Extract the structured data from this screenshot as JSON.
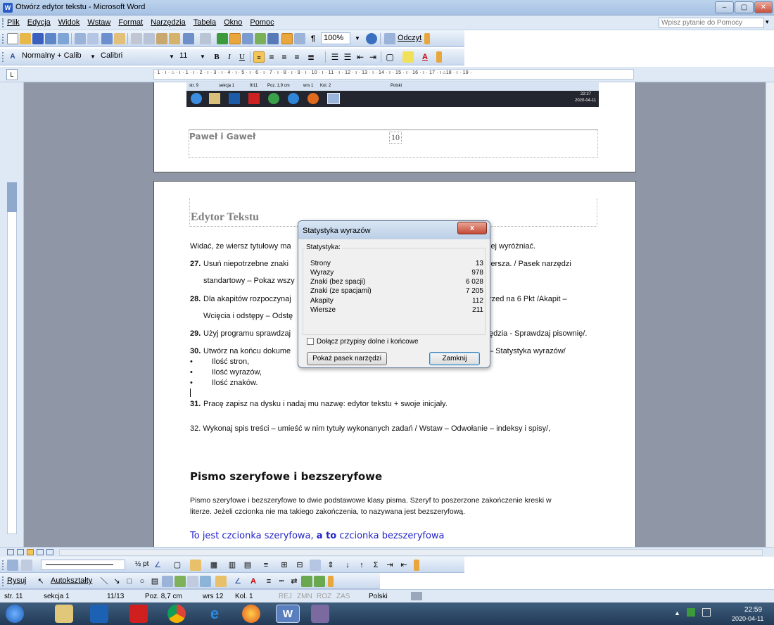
{
  "window": {
    "title": "Otwórz edytor tekstu - Microsoft Word",
    "app_letter": "W"
  },
  "caption_buttons": {
    "minimize": "–",
    "maximize": "▢",
    "close": "✕"
  },
  "menu": [
    "Plik",
    "Edycja",
    "Widok",
    "Wstaw",
    "Format",
    "Narzędzia",
    "Tabela",
    "Okno",
    "Pomoc"
  ],
  "help": {
    "placeholder": "Wpisz pytanie do Pomocy",
    "arrow": "▾"
  },
  "toolbar_standard": {
    "zoom": "100%",
    "read_label": "Odczyt"
  },
  "toolbar_format": {
    "style": "Normalny + Calib",
    "font": "Calibri",
    "size": "11",
    "bold": "B",
    "italic": "I",
    "underline": "U"
  },
  "ruler": {
    "corner": "L",
    "numbers": "· 1 · ı · ⌂ · ı · 1 · ı · 2 · ı · 3 · ı · 4 · ı · 5 · ı · 6 · ı · 7 · ı · 8 · ı · 9 · ı · 10 · ı · 11 · ı · 12 · ı · 13 · ı · 14 · ı · 15 · ı · 16 · ı · 17 · ı ⌂18 · ı · 19 ·"
  },
  "page1": {
    "mini_status": [
      "str. 9",
      "sekcja 1",
      "9/11",
      "Poz. 1,9 cm",
      "wrs 1",
      "Kol. 2",
      "Polski"
    ],
    "mini_time": "22:27",
    "mini_date": "2020-04-11",
    "footer_text": "Paweł i Gaweł",
    "page_number": "10"
  },
  "page2": {
    "heading": "Edytor Tekstu",
    "intro_left": "Widać, że wiersz tytułowy ma",
    "intro_right": "iej wyróżniać.",
    "items": [
      {
        "num": "27.",
        "left": "Usuń niepotrzebne znaki",
        "right": "iersza. / Pasek narzędzi"
      },
      {
        "num": "",
        "left": "standartowy – Pokaz wszy",
        "right": ""
      },
      {
        "num": "28.",
        "left": "Dla akapitów rozpoczynaj",
        "right": "rzed na 6 Pkt /Akapit –"
      },
      {
        "num": "",
        "left": "Wcięcia i odstępy – Odstę",
        "right": ""
      },
      {
        "num": "29.",
        "left": "Użyj programu sprawdzaj",
        "right": "ędzia - Sprawdzaj pisownię/."
      },
      {
        "num": "30.",
        "left": "Utwórz na końcu dokume",
        "right": "– Statystyka wyrazów/"
      }
    ],
    "bullets": [
      "Ilość stron,",
      "Ilość wyrazów,",
      "Ilość znaków."
    ],
    "bullet_char": "•",
    "item31_num": "31.",
    "item31": "Pracę zapisz na dysku i nadaj mu nazwę: edytor tekstu + swoje inicjały.",
    "item32": "32. Wykonaj spis treści – umieść w nim tytuły wykonanych zadań / Wstaw – Odwołanie – indeksy i spisy/,",
    "heading2": "Pismo szeryfowe i bezszeryfowe",
    "para1": "Pismo szeryfowe i bezszeryfowe to dwie podstawowe klasy pisma. Szeryf to poszerzone zakończenie kreski w",
    "para2": "literze. Jeżeli czcionka nie ma takiego zakończenia, to nazywana jest bezszeryfową.",
    "blue_1": "To jest czcionka szeryfowa, ",
    "blue_bold": "a to",
    "blue_2": " czcionka bezszeryfowa"
  },
  "dialog": {
    "title": "Statystyka wyrazów",
    "close": "x",
    "group_label": "Statystyka:",
    "stats": [
      {
        "label": "Strony",
        "value": "13"
      },
      {
        "label": "Wyrazy",
        "value": "978"
      },
      {
        "label": "Znaki (bez spacji)",
        "value": "6 028"
      },
      {
        "label": "Znaki (ze spacjami)",
        "value": "7 205"
      },
      {
        "label": "Akapity",
        "value": "112"
      },
      {
        "label": "Wiersze",
        "value": "211"
      }
    ],
    "checkbox": "Dołącz przypisy dolne i końcowe",
    "show_toolbar": "Pokaż pasek narzędzi",
    "close_button": "Zamknij"
  },
  "drawing": {
    "rysuj": "Rysuj",
    "autoshapes": "Autokształty",
    "line_weight": "½ pt"
  },
  "status": {
    "page": "str. 11",
    "section": "sekcja 1",
    "pages": "11/13",
    "pos": "Poz. 8,7 cm",
    "line": "wrs 12",
    "col": "Kol. 1",
    "rej": "REJ",
    "zmn": "ZMN",
    "roz": "ROZ",
    "zas": "ZAS",
    "lang": "Polski"
  },
  "taskbar": {
    "time": "22:59",
    "date": "2020-04-11"
  },
  "colors": {
    "accent_blue": "#2323c8",
    "heading_gray": "#7f7f7f",
    "workspace": "#8f97a6"
  }
}
